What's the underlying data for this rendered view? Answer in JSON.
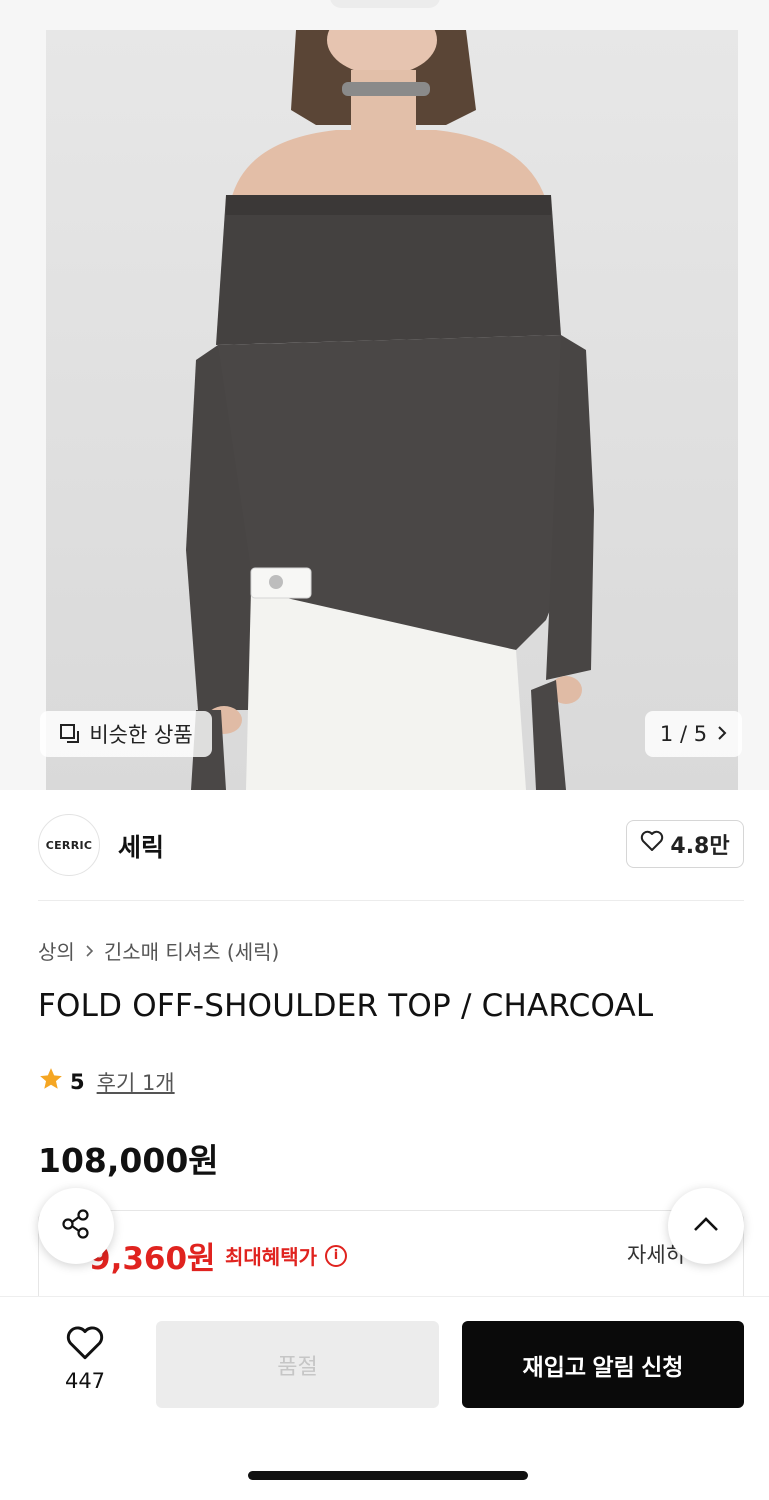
{
  "gallery": {
    "similar_label": "비슷한 상품",
    "counter": "1 / 5"
  },
  "brand": {
    "logo_text": "CERRIC",
    "name": "세릭",
    "likes": "4.8만"
  },
  "breadcrumb": {
    "category": "상의",
    "subcategory": "긴소매 티셔츠 (세릭)"
  },
  "product": {
    "title": "FOLD OFF-SHOULDER TOP / CHARCOAL",
    "rating": "5",
    "reviews_label": "후기 1개",
    "price": "108,000원"
  },
  "benefit": {
    "price": "9,360원",
    "label": "최대혜택가",
    "detail": "자세히"
  },
  "bottom_bar": {
    "wish_count": "447",
    "soldout_label": "품절",
    "restock_label": "재입고 알림 신청"
  },
  "colors": {
    "accent_red": "#e0231f",
    "primary_black": "#0a0a0a",
    "star": "#f5a623",
    "disabled_bg": "#ececec"
  }
}
